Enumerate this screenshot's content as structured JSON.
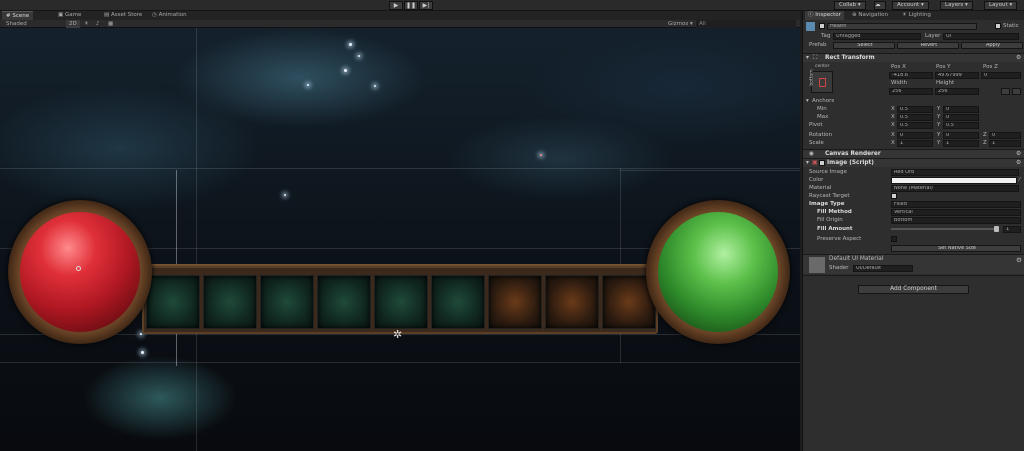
{
  "toolbar": {
    "play_icon": "play-icon",
    "pause_icon": "pause-icon",
    "step_icon": "step-icon",
    "collab": "Collab ▾",
    "account": "Account ▾",
    "layers": "Layers ▾",
    "layout": "Layout ▾",
    "cloud_icon": "cloud-icon"
  },
  "scene": {
    "tabs": [
      "Scene",
      "Game",
      "Asset Store",
      "Animation"
    ],
    "shaded": "Shaded",
    "mode_2d": "2D",
    "gizmos": "Gizmos ▾",
    "search": "All"
  },
  "inspector": {
    "tabs": [
      "Inspector",
      "Navigation",
      "Lighting"
    ],
    "object_name": "Health",
    "static": "Static",
    "tag_label": "Tag",
    "tag_value": "Untagged",
    "layer_label": "Layer",
    "layer_value": "UI",
    "prefab_label": "Prefab",
    "select": "Select",
    "revert": "Revert",
    "apply": "Apply",
    "rect_transform": "Rect Transform",
    "center": "center",
    "bottom": "bottom",
    "pos_x_label": "Pos X",
    "pos_y_label": "Pos Y",
    "pos_z_label": "Pos Z",
    "pos_x": "-418.6",
    "pos_y": "49.67999",
    "pos_z": "0",
    "width_label": "Width",
    "height_label": "Height",
    "width": "256",
    "height": "256",
    "anchors": "Anchors",
    "min": "Min",
    "max": "Max",
    "pivot": "Pivot",
    "min_x": "0.5",
    "min_y": "0",
    "max_x": "0.5",
    "max_y": "0",
    "pivot_x": "0.5",
    "pivot_y": "0.5",
    "rotation": "Rotation",
    "scale": "Scale",
    "rot_x": "0",
    "rot_y": "0",
    "rot_z": "0",
    "scale_x": "1",
    "scale_y": "1",
    "scale_z": "1",
    "axis_x": "X",
    "axis_y": "Y",
    "axis_z": "Z",
    "canvas_renderer": "Canvas Renderer",
    "image_script": "Image (Script)",
    "source_image": "Source Image",
    "source_value": "Red Orb",
    "color": "Color",
    "material": "Material",
    "material_value": "None (Material)",
    "raycast": "Raycast Target",
    "image_type": "Image Type",
    "image_type_value": "Filled",
    "fill_method": "Fill Method",
    "fill_method_value": "Vertical",
    "fill_origin": "Fill Origin",
    "fill_origin_value": "Bottom",
    "fill_amount": "Fill Amount",
    "fill_amount_value": "1",
    "preserve_aspect": "Preserve Aspect",
    "set_native": "Set Native Size",
    "default_material": "Default UI Material",
    "shader_label": "Shader",
    "shader_value": "UI/Default",
    "add_component": "Add Component"
  }
}
